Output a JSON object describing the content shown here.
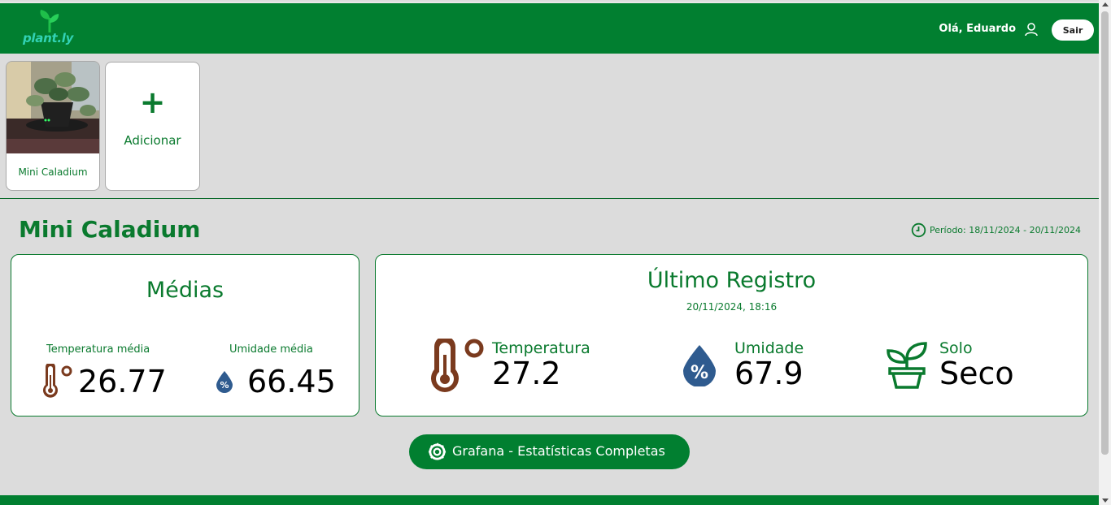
{
  "header": {
    "logo_text": "plant.ly",
    "greeting": "Olá, Eduardo",
    "logout_label": "Sair"
  },
  "plants": {
    "items": [
      {
        "label": "Mini Caladium"
      }
    ],
    "add_label": "Adicionar",
    "add_symbol": "+"
  },
  "selected": {
    "title": "Mini Caladium",
    "period": "Período: 18/11/2024 - 20/11/2024"
  },
  "averages": {
    "title": "Médias",
    "temperature_label": "Temperatura média",
    "temperature_value": "26.77",
    "humidity_label": "Umidade média",
    "humidity_value": "66.45"
  },
  "last_record": {
    "title": "Último Registro",
    "datetime": "20/11/2024, 18:16",
    "temperature_label": "Temperatura",
    "temperature_value": "27.2",
    "humidity_label": "Umidade",
    "humidity_value": "67.9",
    "soil_label": "Solo",
    "soil_value": "Seco"
  },
  "grafana_label": "Grafana - Estatísticas Completas",
  "colors": {
    "brand_green": "#017f30",
    "text_green": "#0a7a2e",
    "thermometer_brown": "#7a3a1e",
    "humidity_blue": "#2f5b8f"
  }
}
